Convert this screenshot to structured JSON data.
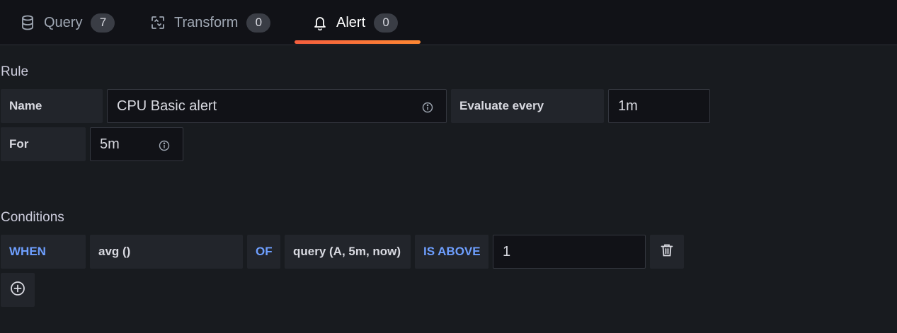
{
  "tabs": [
    {
      "label": "Query",
      "count": "7",
      "icon": "database-icon"
    },
    {
      "label": "Transform",
      "count": "0",
      "icon": "transform-icon"
    },
    {
      "label": "Alert",
      "count": "0",
      "icon": "bell-icon"
    }
  ],
  "active_tab": "Alert",
  "accent_color": "#f55f3e",
  "rule": {
    "title": "Rule",
    "name_label": "Name",
    "name_value": "CPU Basic alert",
    "evaluate_label": "Evaluate every",
    "evaluate_value": "1m",
    "for_label": "For",
    "for_value": "5m"
  },
  "conditions": {
    "title": "Conditions",
    "when": "WHEN",
    "reducer": "avg ()",
    "of": "OF",
    "query": "query (A, 5m, now)",
    "evaluator": "IS ABOVE",
    "threshold": "1"
  }
}
